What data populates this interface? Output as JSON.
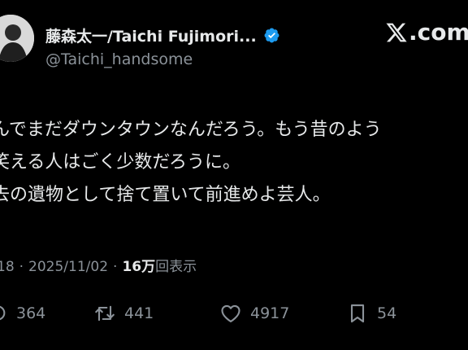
{
  "author": {
    "display_name": "藤森太一/Taichi Fujimori...",
    "handle": "@Taichi_handsome",
    "verified": true,
    "avatar": "user-avatar"
  },
  "brand": {
    "suffix": ".com",
    "icon": "x-logo-icon"
  },
  "tweet": {
    "lines": [
      "んでまだダウンタウンなんだろう。もう昔のよう",
      "笑える人はごく少数だろうに。",
      "去の遺物として捨て置いて前進めよ芸人。"
    ],
    "time": "18",
    "date": "2025/11/02",
    "views_count": "16万",
    "views_label": "回表示"
  },
  "actions": {
    "replies": "364",
    "reposts": "441",
    "likes": "4917",
    "bookmarks": "54"
  },
  "colors": {
    "background": "#000000",
    "text": "#e7e9ea",
    "muted": "#8b9299",
    "verified": "#1d9bf0"
  }
}
